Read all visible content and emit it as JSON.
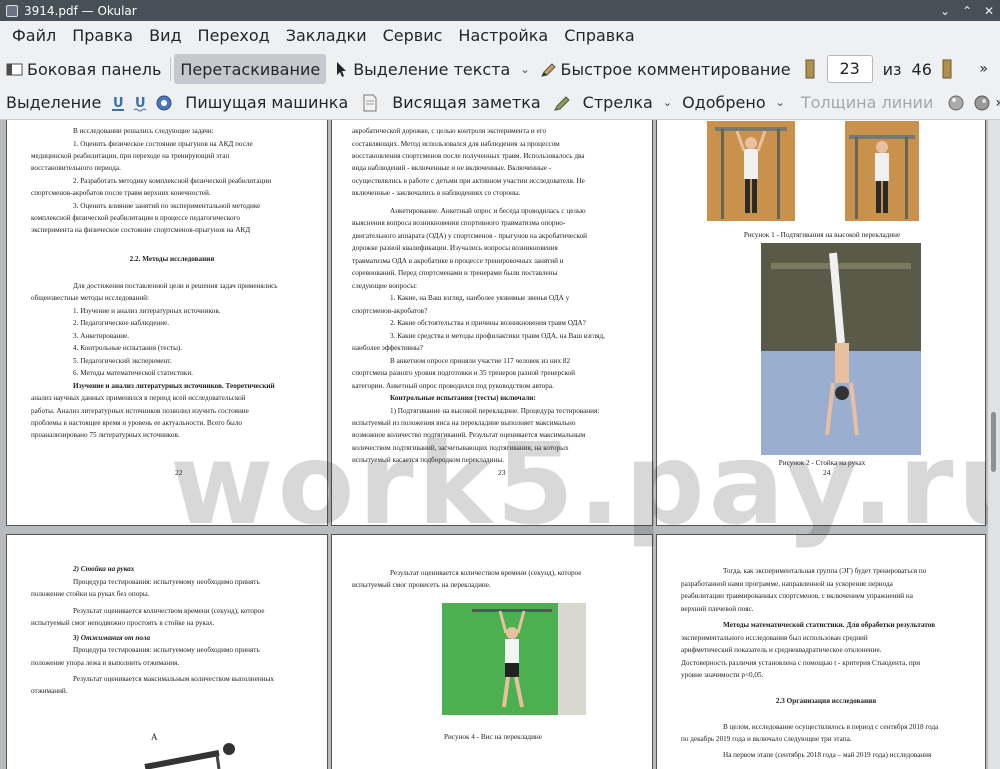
{
  "window": {
    "title": "3914.pdf — Okular",
    "minimize": "⌄",
    "maximize": "⌃",
    "close": "✕"
  },
  "menu": [
    "Файл",
    "Правка",
    "Вид",
    "Переход",
    "Закладки",
    "Сервис",
    "Настройка",
    "Справка"
  ],
  "toolbar1": {
    "sidebar": "Боковая панель",
    "drag": "Перетаскивание",
    "text_select": "Выделение текста",
    "quick_comment": "Быстрое комментирование",
    "page_current": "23",
    "page_of": "из",
    "page_total": "46",
    "more": "»"
  },
  "toolbar2": {
    "selection": "Выделение",
    "typewriter": "Пишущая машинка",
    "pinned_note": "Висящая заметка",
    "arrow": "Стрелка",
    "approved": "Одобрено",
    "line_width": "Толщина линии",
    "more": "»"
  },
  "pages": {
    "p22": {
      "lines": [
        "В исследовании решались следующие задачи:",
        "1.  Оценить  физическое  состояние  прыгунов  на  АКД  после",
        "медицинской реабилитации, при переходе на тренирующий этап",
        "восстановительного периода.",
        "2.  Разработать  методику  комплексной  физической  реабилитации",
        "спортсменов-акробатов после травм верхних конечностей.",
        "3.  Оценить  влияние  занятий  по  экспериментальной  методике",
        "комплексной  физической  реабилитации  в  процессе  педагогического",
        "эксперимента на физическое состояние спортсменов-прыгунов на АКД",
        "2.2. Методы исследования",
        "Для достижения поставленной цели и решения задач применялись",
        "общеизвестные методы исследований:",
        "1. Изучение и анализ литературных источников.",
        "2. Педагогическое наблюдение.",
        "3. Анкетирование.",
        "4. Контрольные испытания (тесты).",
        "5. Педагогический эксперимент.",
        "6. Методы математической статистики.",
        "Изучение и анализ литературных источников. Теоретический",
        "анализ научных данных применялся в период всей исследовательской",
        "работы. Анализ литературных источников позволил изучить состояние",
        "проблемы в настоящее время и уровень ее актуальности. Всего было",
        "проанализировано 75 литературных источников."
      ],
      "number": "22"
    },
    "p23": {
      "lines": [
        "акробатической дорожке, с целью контроля эксперимента и его",
        "составляющих. Метод использовался для наблюдения за процессом",
        "восстановления спортсменов после полученных травм. Использовалось два",
        "вида наблюдений - включенные и не включенные. Включенные -",
        "осуществлялись в работе с детьми при активном участии исследователя. Не",
        "включенные - заключались в наблюдениях со стороны.",
        "Анкетирование. Анкетный опрос и беседа проводилась с целью",
        "выяснения вопроса возникновения спортивного травматизма опорно-",
        "двигательного аппарата (ОДА) у спортсменов - прыгунов на акробатической",
        "дорожке разной квалификации. Изучались вопросы возникновения",
        "травматизма ОДА в акробатике в процессе тренировочных занятий и",
        "соревнований. Перед спортсменами и тренерами были поставлены",
        "следующие вопросы:",
        "1. Какие, на Ваш взгляд, наиболее уязвимые звенья ОДА у",
        "спортсменов-акробатов?",
        "2. Какие обстоятельства и причины возникновения травм ОДА?",
        "3. Какие средства и методы профилактики травм ОДА, на Ваш взгляд,",
        "наиболее эффективны?",
        "В анкетном опросе приняли участие 117 человек из них 82",
        "спортсмена разного уровня подготовки и 35 тренеров разной тренерской",
        "категории. Анкетный опрос проводился под руководством автора.",
        "Контрольные испытания (тесты) включали:",
        "1) Подтягивание на высокой перекладине. Процедура тестирования:",
        "испытуемый из положения виса на перекладине выполняет максимально",
        "возможное количество подтягиваний. Результат оценивается максимальным",
        "количеством подтягиваний, засчитывающих подтягивания, на которых",
        "испытуемый касается подбородком перекладины."
      ],
      "number": "23"
    },
    "p24": {
      "caption1": "Рисунок 1 - Подтягивания на высокой перекладине",
      "caption2": "Рисунок 2 - Стойка на руках",
      "number": "24"
    },
    "p25": {
      "lines": [
        "2) Стойка на руках",
        "Процедура тестирования: испытуемому необходимо принять",
        "положение стойки на руках без опоры.",
        "Результат оценивается количеством времени (секунд), которое",
        "испытуемый смог неподвижно простоять в стойке на руках.",
        "3) Отжимания от пола",
        "Процедура тестирования: испытуемому необходимо принять",
        "положение упора лежа и выполнить отжимания.",
        "Результат оценивается максимальным количеством выполненных",
        "отжиманий."
      ],
      "label_a": "А"
    },
    "p26": {
      "lines": [
        "Результат оценивается количеством времени (секунд), которое",
        "испытуемый смог провисеть на перекладине."
      ],
      "caption4": "Рисунок 4 - Вис на перекладине"
    },
    "p27": {
      "lines": [
        "Тогда, как экспериментальная группа (ЭГ) будет тренироваться по",
        "разработанной нами программе, направленной на ускорение периода",
        "реабилитации травмированных спортсменов, с включением упражнений на",
        "верхний плечевой пояс.",
        "Методы математической статистики. Для обработки результатов",
        "экспериментального исследования был использован средний",
        "арифметический показатель и среднеквадратическое отклонение.",
        "Достоверность различия установлена с помощью t - критерия Стьюдента, при",
        "уровне значимости p<0,05.",
        "2.3 Организация исследования",
        "В целом, исследование осуществлялось в период с сентября 2018 года",
        "по декабрь 2019 года и включало следующие три этапа.",
        "На первом этапе (сентябрь 2018 года – май 2019 года) исследования"
      ]
    }
  },
  "watermark": "work5.pay.ru"
}
